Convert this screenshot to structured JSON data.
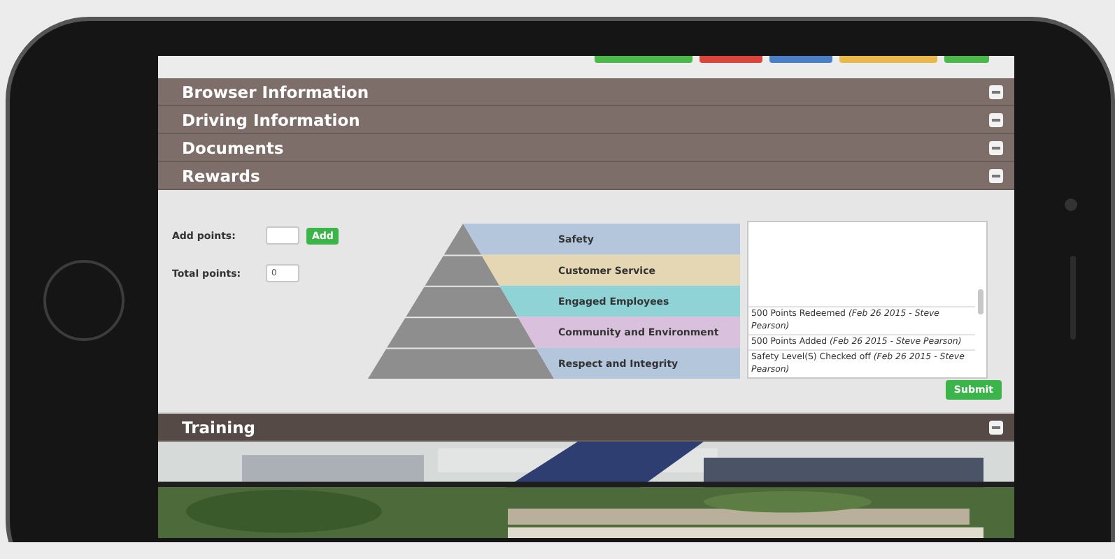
{
  "header_buttons": [
    {
      "color": "#4cb84a"
    },
    {
      "color": "#d9453a"
    },
    {
      "color": "#4a7fc8"
    },
    {
      "color": "#e9b84a"
    },
    {
      "color": "#4cb84a"
    }
  ],
  "sections": [
    {
      "title": "Browser Information",
      "highlighted": false
    },
    {
      "title": "Driving Information",
      "highlighted": false
    },
    {
      "title": "Documents",
      "highlighted": false
    },
    {
      "title": "Rewards",
      "highlighted": false,
      "rewards": {
        "add_points": {
          "label": "Add points:",
          "button": "Add"
        },
        "total_points": {
          "label": "Total points:",
          "value": "0"
        },
        "pyramid": [
          {
            "label": "Safety",
            "color": "#b4c6dc"
          },
          {
            "label": "Customer Service",
            "color": "#e6d7b4"
          },
          {
            "label": "Engaged Employees",
            "color": "#8fd3d6"
          },
          {
            "label": "Community and Environment",
            "color": "#d9c0dc"
          },
          {
            "label": "Respect and Integrity",
            "color": "#b4c6dc"
          }
        ],
        "log": [
          "500 Points Redeemed *(Feb 26 2015 - Steve Pearson)*",
          "500 Points Added *(Feb 26 2015 - Steve Pearson)*",
          "Safety Level(S) Checked off *(Feb 26 2015 - Steve Pearson)*"
        ],
        "submit": "Submit"
      }
    },
    {
      "title": "Training",
      "highlighted": true
    }
  ]
}
